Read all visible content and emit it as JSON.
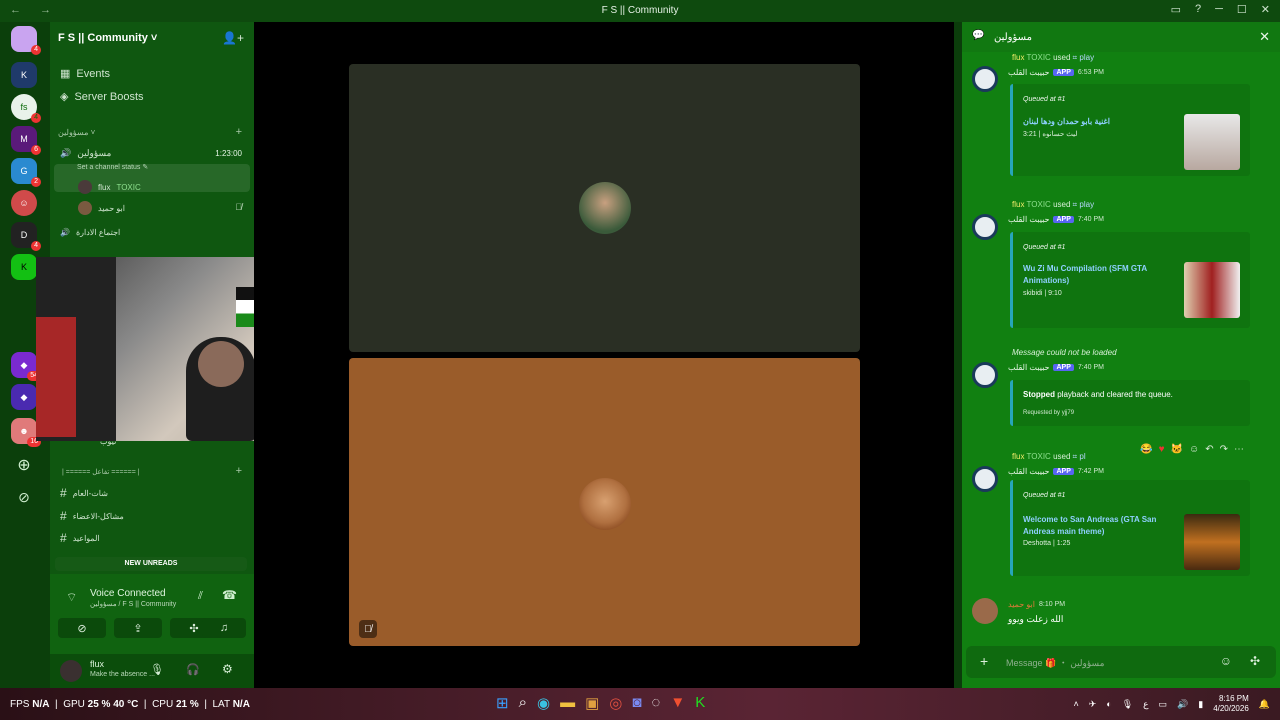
{
  "window": {
    "title": "F S || Community",
    "nav_arrows": "← →",
    "controls": [
      "▭",
      "?",
      "─",
      "☐",
      "✕"
    ]
  },
  "guild_badges": [
    "4",
    "4",
    "6",
    "2",
    "4",
    "54",
    "16"
  ],
  "sidebar": {
    "server_name": "F S || Community ˅",
    "items": [
      {
        "label": "Events"
      },
      {
        "label": "Server Boosts"
      }
    ],
    "category": "مسؤولين ˅",
    "voice_channel": {
      "name": "مسؤولين",
      "status_hint": "Set a channel status ✎",
      "elapsed": "1:23:00"
    },
    "members": [
      {
        "name": "flux",
        "tag": "TOXIC"
      },
      {
        "name": "ابو حميد"
      }
    ],
    "other_voice": "اجتماع الادارة",
    "partial_item": "تيوب",
    "category2": "| ====== تفاعل ====== |",
    "text_channels": [
      {
        "label": "شات-العام"
      },
      {
        "label": "مشاكل-الاعضاء"
      },
      {
        "label": "المواعيد"
      }
    ],
    "new_unreads": "NEW UNREADS"
  },
  "voice_panel": {
    "title": "Voice Connected",
    "subtitle": "مسؤولين / F S || Community"
  },
  "user_panel": {
    "name": "flux",
    "status": "Make the absence ..."
  },
  "chat": {
    "header": "مسؤولين",
    "messages": [
      {
        "reply_user": "flux",
        "reply_tag": "TOXIC",
        "reply_used": "used",
        "reply_cmd": "play",
        "author": "حبيبت القلب",
        "app": "APP",
        "time": "6:53 PM",
        "queued": "Queued at #1",
        "title": "اغنية بابو حمدان ودها لبنان",
        "sub": "ليث حسانوه | 3:21"
      },
      {
        "reply_user": "flux",
        "reply_tag": "TOXIC",
        "reply_used": "used",
        "reply_cmd": "play",
        "author": "حبيبت القلب",
        "app": "APP",
        "time": "7:40 PM",
        "queued": "Queued at #1",
        "title": "Wu Zi Mu Compilation (SFM GTA Animations)",
        "sub": "skibidi | 9:10"
      },
      {
        "reply_text": "Message could not be loaded",
        "author": "حبيبت القلب",
        "app": "APP",
        "time": "7:40 PM",
        "stopped_bold": "Stopped",
        "stopped_rest": "playback and cleared the queue.",
        "requested": "Requested by yjj79"
      },
      {
        "reply_user": "flux",
        "reply_tag": "TOXIC",
        "reply_used": "used",
        "reply_cmd": "pl",
        "author": "حبيبت القلب",
        "app": "APP",
        "time": "7:42 PM",
        "queued": "Queued at #1",
        "title": "Welcome to San Andreas (GTA San Andreas main theme)",
        "sub": "Deshotta | 1:25"
      },
      {
        "author": "ابو حميد",
        "time": "8:10 PM",
        "text": "الله زعلت ويوو"
      }
    ],
    "composer_placeholder": "Message 🎁 ・ مسؤولين"
  },
  "taskbar": {
    "fps_label": "FPS",
    "fps": "N/A",
    "gpu_label": "GPU",
    "gpu": "25 % 40 °C",
    "cpu_label": "CPU",
    "cpu": "21 %",
    "lat_label": "LAT",
    "lat": "N/A",
    "time": "8:16 PM",
    "date": "4/20/2026"
  },
  "colors": {
    "accent": "#5865f2",
    "link": "#8fd0ff",
    "sidebar_bg": "#0f5710",
    "chat_bg": "#118011"
  }
}
